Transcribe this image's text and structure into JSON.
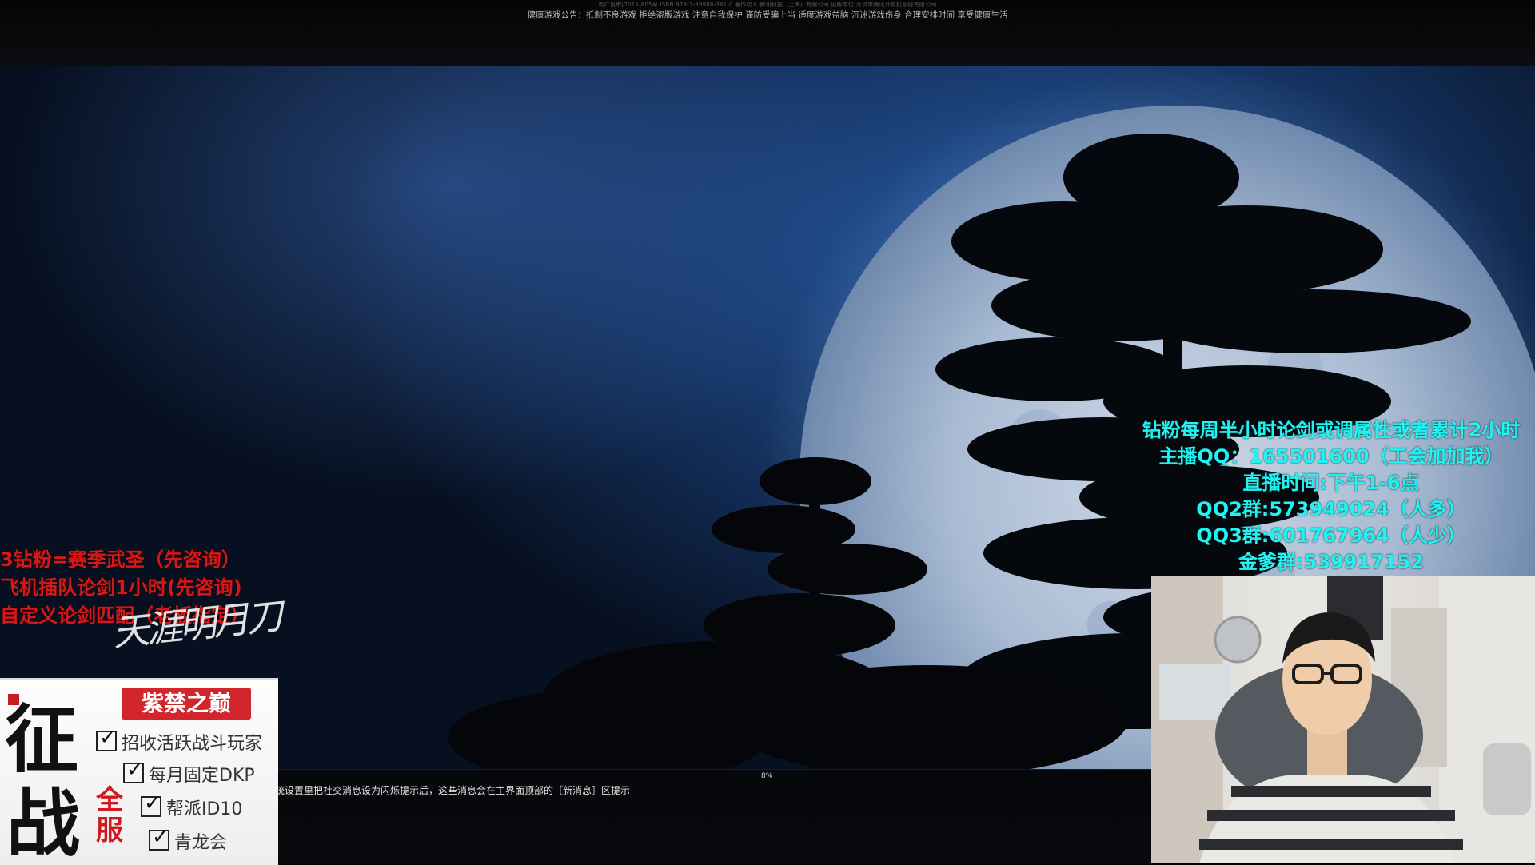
{
  "top_bar": {
    "copyright": "新广出审[2015]805号 ISBN 978-7-89988-381-0 著作权人:腾讯科技（上海）有限公司 出版单位:深圳市腾讯计算机系统有限公司",
    "health_notice": "健康游戏公告：抵制不良游戏 拒绝盗版游戏 注意自我保护 谨防受骗上当 适度游戏益脑 沉迷游戏伤身 合理安排时间 享受健康生活"
  },
  "game": {
    "progress_percent": "8%",
    "system_message": "统设置里把社交消息设为闪烁提示后，这些消息会在主界面顶部的［新消息］区提示",
    "calligraphy_logo": "天涯明月刀"
  },
  "red_notes": [
    "3钻粉=赛季武圣（先咨询）",
    "飞机插队论剑1小时(先咨询)",
    "自定义论剑匹配（老板指定）"
  ],
  "stream_info": [
    "钻粉每周半小时论剑或调属性或者累计2小时",
    "主播QQ：165501600（工会加加我）",
    "直播时间:下午1-6点",
    "QQ2群:573949024（人多）",
    "QQ3群:601767964（人少）",
    "金爹群:539917152"
  ],
  "guild_banner": {
    "logo_text": "征战",
    "guild_name": "紫禁之巅",
    "server_badge": "全服",
    "perks": [
      "招收活跃战斗玩家",
      "每月固定DKP",
      "帮派ID10",
      "青龙会"
    ]
  },
  "colors": {
    "red_text": "#d81818",
    "cyan_text": "#21f2f2",
    "guild_red": "#d3262c"
  }
}
